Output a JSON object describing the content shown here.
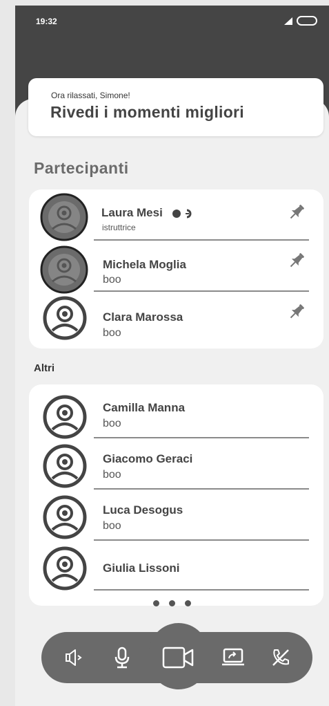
{
  "status_bar": {
    "time": "19:32"
  },
  "banner": {
    "subtitle": "Ora rilassati, Simone!",
    "title": "Rivedi i momenti migliori"
  },
  "participants": {
    "title": "Partecipanti",
    "items": [
      {
        "name": "Laura Mesi",
        "role": "istruttrice",
        "pinned": true,
        "highlighted": true
      },
      {
        "name": "Michela Moglia",
        "role": "boo",
        "pinned": true,
        "highlighted": true
      },
      {
        "name": "Clara Marossa",
        "role": "boo",
        "pinned": true,
        "highlighted": false
      }
    ]
  },
  "others": {
    "title": "Altri",
    "items": [
      {
        "name": "Camilla Manna",
        "role": "boo"
      },
      {
        "name": "Giacomo Geraci",
        "role": "boo"
      },
      {
        "name": "Luca Desogus",
        "role": "boo"
      },
      {
        "name": "Giulia Lissoni",
        "role": ""
      }
    ]
  },
  "pagination": {
    "dots": 3
  },
  "controls": [
    "speaker-icon",
    "microphone-icon",
    "video-camera-icon",
    "screen-share-icon",
    "end-call-icon"
  ],
  "colors": {
    "topbar": "#454545",
    "controls": "#6a6a6a",
    "background": "#f0f0f0"
  }
}
